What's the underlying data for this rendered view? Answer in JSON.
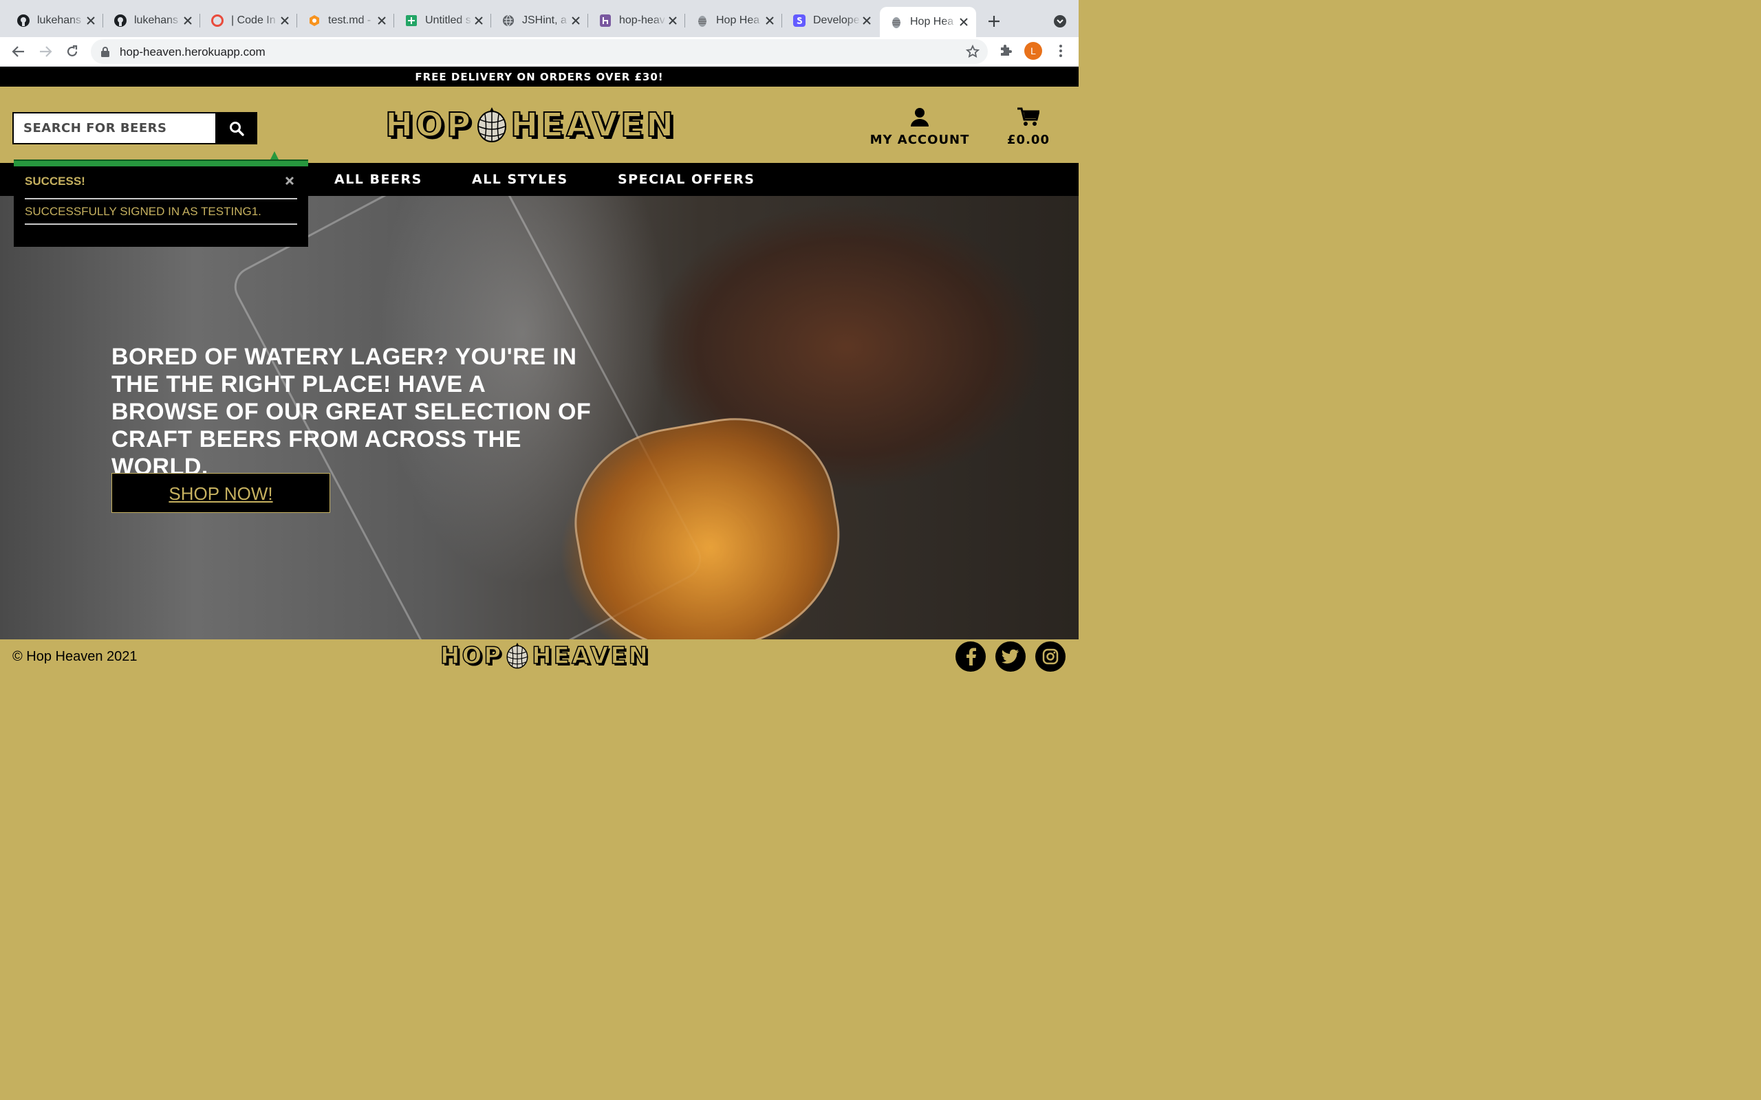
{
  "browser": {
    "tabs": [
      {
        "title": "lukehans",
        "icon": "github-icon"
      },
      {
        "title": "lukehans",
        "icon": "github-icon"
      },
      {
        "title": "| Code In",
        "icon": "code-institute-icon"
      },
      {
        "title": "test.md -",
        "icon": "markdown-icon"
      },
      {
        "title": "Untitled s",
        "icon": "sheets-icon"
      },
      {
        "title": "JSHint, a",
        "icon": "globe-icon"
      },
      {
        "title": "hop-heav",
        "icon": "heroku-icon"
      },
      {
        "title": "Hop Hea",
        "icon": "hop-icon"
      },
      {
        "title": "Develope",
        "icon": "stripe-icon"
      },
      {
        "title": "Hop Hea",
        "icon": "hop-icon"
      }
    ],
    "active_tab": 9,
    "url": "hop-heaven.herokuapp.com",
    "profile_initial": "L"
  },
  "site": {
    "banner": "FREE DELIVERY ON ORDERS OVER £30!",
    "search_placeholder": "SEARCH FOR BEERS",
    "logo_left": "HOP",
    "logo_right": "HEAVEN",
    "account_label": "MY ACCOUNT",
    "cart_total": "£0.00",
    "nav": [
      "ALL BEERS",
      "ALL STYLES",
      "SPECIAL OFFERS"
    ],
    "toast": {
      "heading": "SUCCESS!",
      "message": "Successfully signed in as testing1."
    },
    "hero": {
      "text": "BORED OF WATERY LAGER? YOU'RE IN THE THE RIGHT PLACE! HAVE A BROWSE OF OUR GREAT SELECTION OF CRAFT BEERS FROM ACROSS THE WORLD.",
      "button": "SHOP NOW!"
    },
    "footer": {
      "copyright": "© Hop Heaven 2021",
      "social": [
        "facebook-icon",
        "twitter-icon",
        "instagram-icon"
      ]
    }
  },
  "colors": {
    "brand_gold": "#c5b05f",
    "black": "#000000",
    "success_green": "#27983e"
  }
}
